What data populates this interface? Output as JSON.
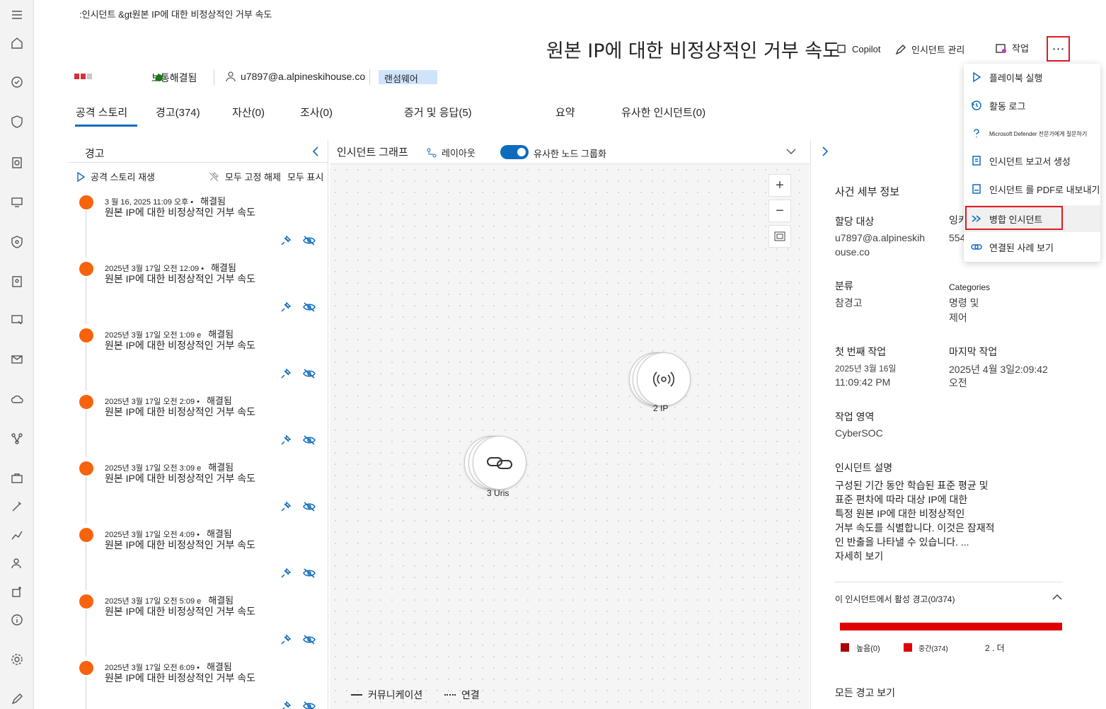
{
  "breadcrumb": ":인시던트 &gt원본 IP에 대한 비정상적인 거부 속도",
  "title": "원본 IP에 대한 비정상적인 거부 속도",
  "commands": {
    "copilot": "Copilot",
    "manage": "인시던트 관리",
    "action": "작업",
    "more": "⋯"
  },
  "colors": {
    "accent": "#0f6cbd",
    "high": "#a80000",
    "medium": "#e00000",
    "low": "#c8c8c8",
    "alert_dot": "#f7630c"
  },
  "status": {
    "state": "보통해결됨",
    "assignee": "u7897@a.alpineskihouse.co",
    "tag": "랜섬웨어"
  },
  "tabs": [
    "공격 스토리",
    "경고(374)",
    "자산(0)",
    "조사(0)",
    "증거 및 응답(5)",
    "요약",
    "유사한 인시던트(0)"
  ],
  "alerts_pane": {
    "title": "경고",
    "replay": "공격 스토리 재생",
    "unpin_all": "모두 고정 해제",
    "show_all": "모두 표시",
    "items": [
      {
        "time": "3 월 16, 2025 11:09 오후 •",
        "status": "해결됨",
        "title": "원본 IP에 대한 비정상적인 거부 속도"
      },
      {
        "time": "2025년 3월 17일 오전 12:09 •",
        "status": "해결됨",
        "title": "원본 IP에 대한 비정상적인 거부 속도"
      },
      {
        "time": "2025년 3월 17일 오전 1:09 e",
        "status": "해결됨",
        "title": "원본 IP에 대한 비정상적인 거부 속도"
      },
      {
        "time": "2025년 3월 17일 오전 2:09 •",
        "status": "해결됨",
        "title": "원본 IP에 대한 비정상적인 거부 속도"
      },
      {
        "time": "2025년 3월 17일 오전 3:09 e",
        "status": "해결됨",
        "title": "원본 IP에 대한 비정상적인 거부 속도"
      },
      {
        "time": "2025년 3월 17일 오전 4:09 •",
        "status": "해결됨",
        "title": "원본 IP에 대한 비정상적인 거부 속도"
      },
      {
        "time": "2025년 3월 17일 오전 5:09 e",
        "status": "해결됨",
        "title": "원본 IP에 대한 비정상적인 거부 속도"
      },
      {
        "time": "2025년 3월 17일 오전 6:09 •",
        "status": "해결됨",
        "title": "원본 IP에 대한 비정상적인 거부 속도"
      }
    ]
  },
  "graph": {
    "title": "인시던트 그래프",
    "layout": "레이아웃",
    "group_similar": "유사한 노드 그룹화",
    "nodes": [
      {
        "count": "2",
        "label": "IP"
      },
      {
        "count": "3",
        "label": "Uris"
      }
    ],
    "legend": {
      "communication": "커뮤니케이션",
      "association": "연결"
    }
  },
  "details": {
    "section": "사건 세부 정보",
    "assigned_label": "할당 대상",
    "assigned_value_1": "u7897@a.alpineskih",
    "assigned_value_2": "ouse.co",
    "id_label": "잉키",
    "id_value": "554",
    "classification_label": "분류",
    "classification_value": "참경고",
    "categories_label": "Categories",
    "categories_value_1": "명령 및",
    "categories_value_2": "제어",
    "first_activity_label": "첫 번째 작업",
    "first_activity_1": "2025년 3월 16일",
    "first_activity_2": "11:09:42 PM",
    "last_activity_label": "마지막 작업",
    "last_activity_1": "2025년 4월 3일2:09:42",
    "last_activity_2": "오전",
    "workspace_label": "작업 영역",
    "workspace_value": "CyberSOC",
    "description_label": "인시던트 설명",
    "description_lines": [
      "구성된 기간 동안 학습된 표준 평균 및",
      "표준 편차에 따라 대상 IP에 대한",
      "특정 원본 IP에 대한 비정상적인",
      "거부 속도를 식별합니다. 이것은 잠재적",
      "인 반출을 나타낼 수 있습니다. ..."
    ],
    "see_more": "자세히 보기",
    "active_alerts": "이 인시던트에서 활성 경고(0/374)",
    "legend_high": "높음(0)",
    "legend_medium": "중간(374)",
    "legend_more": "2 . 더",
    "view_all": "모든 경고 보기"
  },
  "menu": [
    {
      "label": "플레이북 실행",
      "icon": "play-icon"
    },
    {
      "label": "활동 로그",
      "icon": "history-icon"
    },
    {
      "label": "Microsoft Defender 전문가에게 질문하기",
      "icon": "question-icon"
    },
    {
      "label": "인시던트 보고서 생성",
      "icon": "report-icon"
    },
    {
      "label": "인시던트 를 PDF로 내보내기",
      "icon": "pdf-icon"
    },
    {
      "label": "병합 인시던트",
      "icon": "merge-icon"
    },
    {
      "label": "연결된 사례 보기",
      "icon": "link-icon"
    }
  ]
}
